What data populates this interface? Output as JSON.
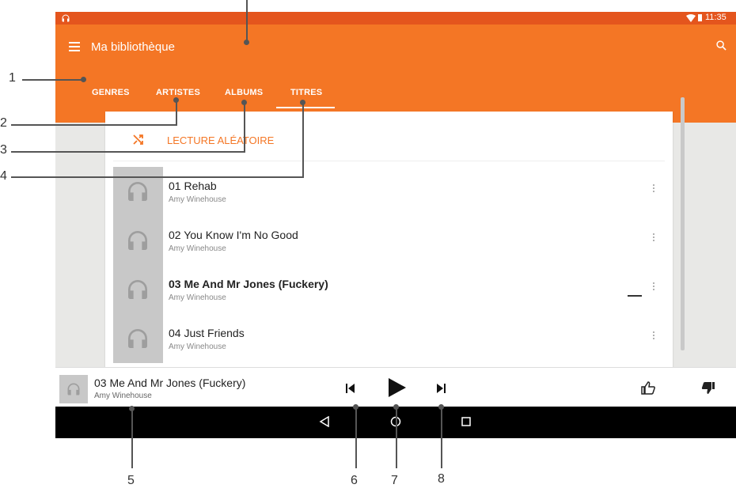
{
  "status": {
    "time": "11:35"
  },
  "appbar": {
    "title": "Ma bibliothèque"
  },
  "tabs": [
    "GENRES",
    "ARTISTES",
    "ALBUMS",
    "TITRES"
  ],
  "shuffle": {
    "label": "LECTURE ALÉATOIRE"
  },
  "tracks": [
    {
      "title": "01 Rehab",
      "artist": "Amy Winehouse"
    },
    {
      "title": "02 You Know I'm No Good",
      "artist": "Amy Winehouse"
    },
    {
      "title": "03 Me And Mr Jones (Fuckery)",
      "artist": "Amy Winehouse"
    },
    {
      "title": "04 Just Friends",
      "artist": "Amy Winehouse"
    }
  ],
  "now_playing": {
    "title": "03 Me And Mr Jones (Fuckery)",
    "artist": "Amy Winehouse"
  },
  "callouts": [
    "1",
    "2",
    "3",
    "4",
    "5",
    "6",
    "7",
    "8"
  ],
  "colors": {
    "accent": "#f47625",
    "statusbar": "#e4551d"
  },
  "icons": [
    "headphones-icon",
    "menu-icon",
    "search-icon",
    "shuffle-icon",
    "more-vert-icon",
    "skip-previous-icon",
    "play-icon",
    "skip-next-icon",
    "thumb-up-icon",
    "thumb-down-icon",
    "back-icon",
    "home-icon",
    "recents-icon",
    "wifi-icon",
    "battery-icon"
  ]
}
